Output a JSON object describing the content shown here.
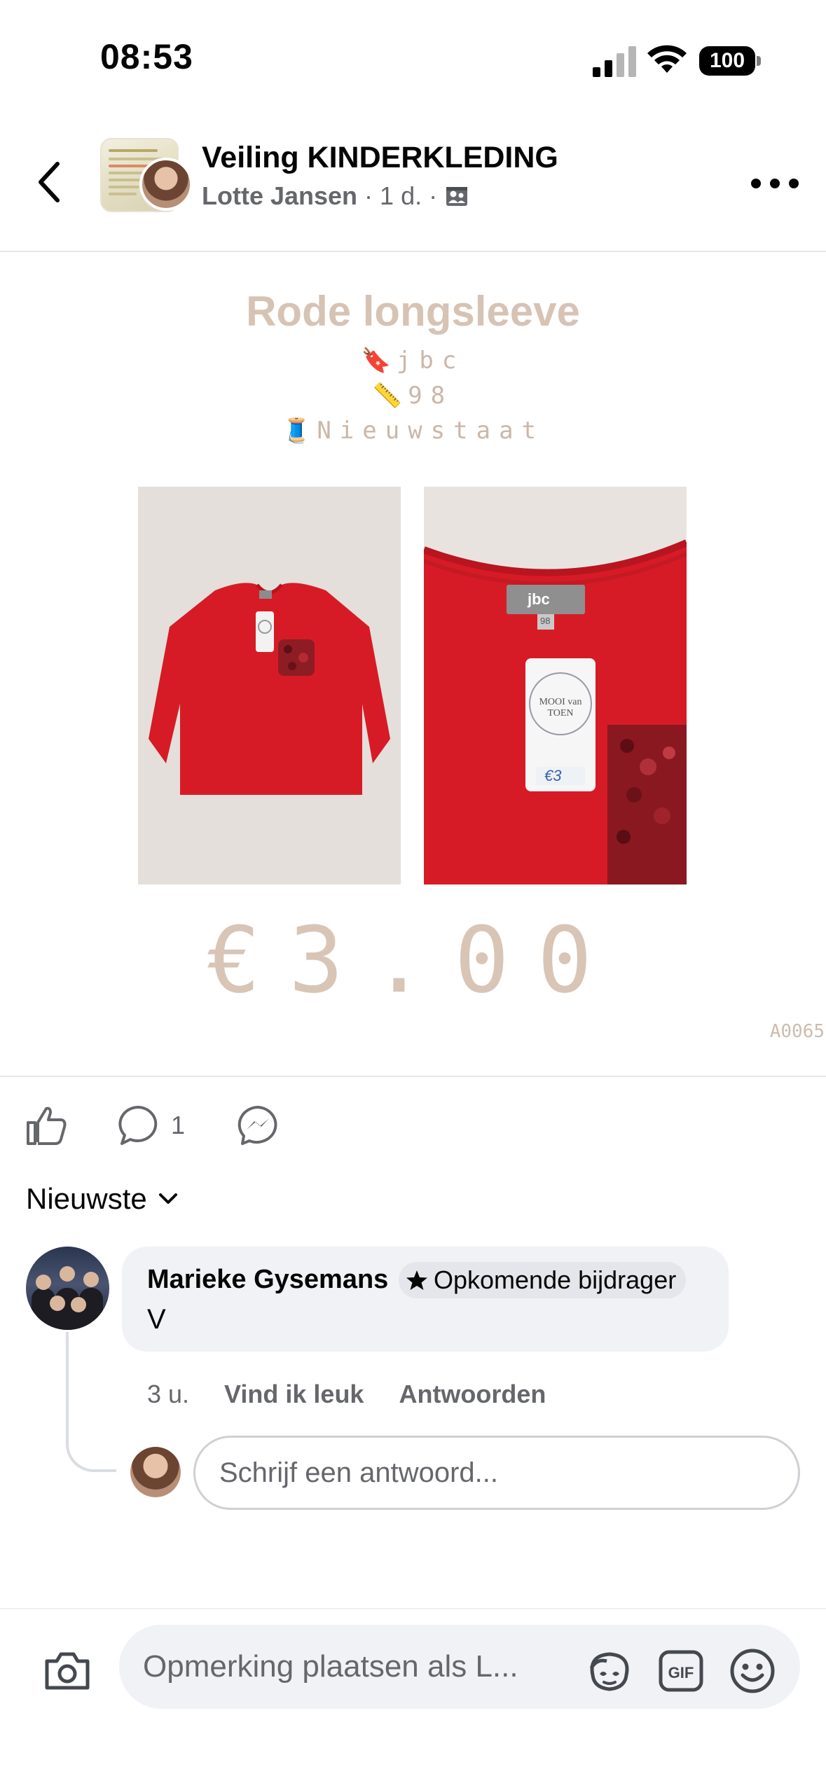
{
  "status_bar": {
    "time": "08:53",
    "battery": "100"
  },
  "header": {
    "group_title": "Veiling KINDERKLEDING",
    "author": "Lotte Jansen",
    "time_ago": "1 d."
  },
  "post": {
    "title": "Rode longsleeve",
    "specs": [
      {
        "icon": "bookmark-emoji",
        "glyph": "🔖",
        "text": "jbc"
      },
      {
        "icon": "ruler-emoji",
        "glyph": "📏",
        "text": "98"
      },
      {
        "icon": "thread-emoji",
        "glyph": "🧵",
        "text": "Nieuwstaat"
      }
    ],
    "photo_2_tag_label": "jbc",
    "photo_2_tag_size": "98",
    "photo_2_hangtag_brand": "MOOI van TOEN",
    "photo_2_price_tag": "€3",
    "price": "€3.00",
    "code": "A0065"
  },
  "actions": {
    "comment_count": "1"
  },
  "sort": {
    "label": "Nieuwste"
  },
  "comment": {
    "author": "Marieke Gysemans",
    "badge": "Opkomende bijdrager",
    "text": "V",
    "time": "3 u.",
    "like_label": "Vind ik leuk",
    "reply_label": "Antwoorden"
  },
  "reply": {
    "placeholder": "Schrijf een antwoord..."
  },
  "composer": {
    "placeholder": "Opmerking plaatsen als L..."
  },
  "colors": {
    "post_text": "#d7c3b4",
    "shirt_red": "#d81e28",
    "meta_gray": "#65676b"
  }
}
